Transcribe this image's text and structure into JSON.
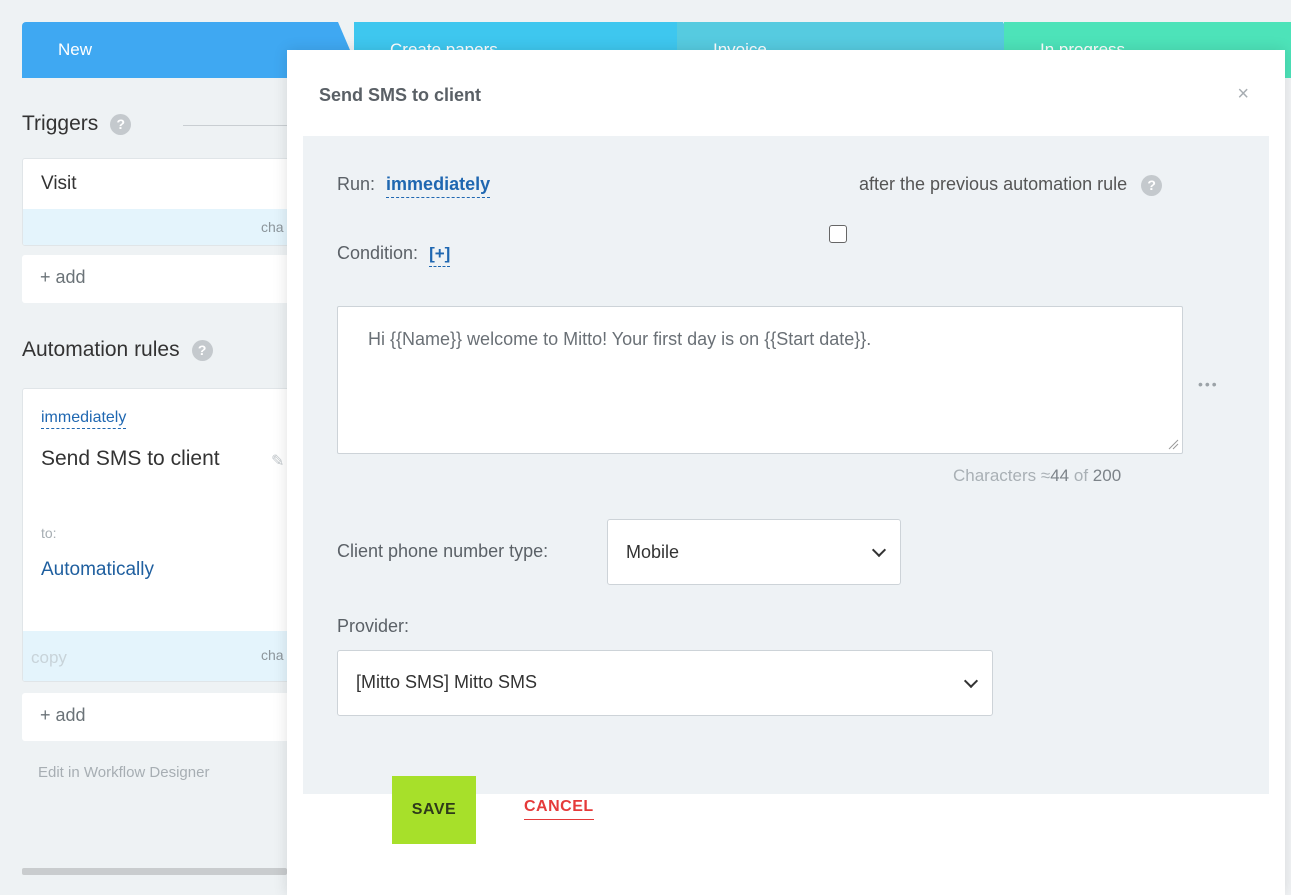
{
  "stages": [
    {
      "label": "New",
      "color": "#3fa8f2"
    },
    {
      "label": "Create papers",
      "color": "#3ec7ef"
    },
    {
      "label": "Invoice",
      "color": "#56cbe0"
    },
    {
      "label": "In progress",
      "color": "#4de3b9"
    }
  ],
  "left": {
    "triggers_title": "Triggers",
    "trigger_card": {
      "name": "Visit",
      "footer_action": "cha"
    },
    "add_label": "+ add",
    "automation_title": "Automation rules",
    "rule_card": {
      "run": "immediately",
      "name": "Send SMS to client",
      "to_label": "to:",
      "to_value": "Automatically",
      "copy_label": "copy",
      "footer_action": "cha"
    },
    "add_label_2": "+ add",
    "workflow_link": "Edit in Workflow Designer"
  },
  "modal": {
    "title": "Send SMS to client",
    "close": "×",
    "run_label": "Run:",
    "run_value": "immediately",
    "after_previous": "after the previous automation rule",
    "condition_label": "Condition:",
    "condition_add": "[+]",
    "message": "Hi {{Name}} welcome to Mitto! Your first day is on {{Start date}}.",
    "more": "•••",
    "counter_prefix": "Characters ≈",
    "counter_count": "44",
    "counter_of": "of",
    "counter_max": "200",
    "phone_type_label": "Client phone number type:",
    "phone_type_value": "Mobile",
    "provider_label": "Provider:",
    "provider_value": "[Mitto SMS] Mitto SMS",
    "save": "SAVE",
    "cancel": "CANCEL"
  }
}
